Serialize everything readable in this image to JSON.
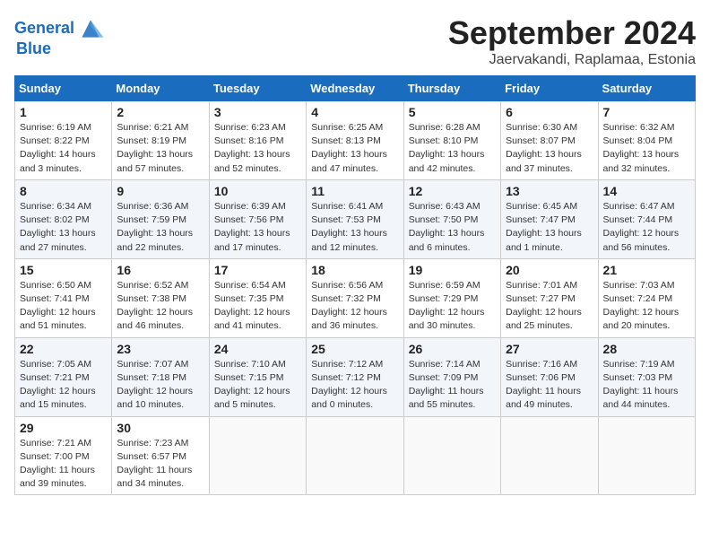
{
  "header": {
    "logo_line1": "General",
    "logo_line2": "Blue",
    "title": "September 2024",
    "subtitle": "Jaervakandi, Raplamaa, Estonia"
  },
  "calendar": {
    "weekdays": [
      "Sunday",
      "Monday",
      "Tuesday",
      "Wednesday",
      "Thursday",
      "Friday",
      "Saturday"
    ],
    "weeks": [
      [
        {
          "day": "",
          "detail": ""
        },
        {
          "day": "2",
          "detail": "Sunrise: 6:21 AM\nSunset: 8:19 PM\nDaylight: 13 hours\nand 57 minutes."
        },
        {
          "day": "3",
          "detail": "Sunrise: 6:23 AM\nSunset: 8:16 PM\nDaylight: 13 hours\nand 52 minutes."
        },
        {
          "day": "4",
          "detail": "Sunrise: 6:25 AM\nSunset: 8:13 PM\nDaylight: 13 hours\nand 47 minutes."
        },
        {
          "day": "5",
          "detail": "Sunrise: 6:28 AM\nSunset: 8:10 PM\nDaylight: 13 hours\nand 42 minutes."
        },
        {
          "day": "6",
          "detail": "Sunrise: 6:30 AM\nSunset: 8:07 PM\nDaylight: 13 hours\nand 37 minutes."
        },
        {
          "day": "7",
          "detail": "Sunrise: 6:32 AM\nSunset: 8:04 PM\nDaylight: 13 hours\nand 32 minutes."
        }
      ],
      [
        {
          "day": "1",
          "detail": "Sunrise: 6:19 AM\nSunset: 8:22 PM\nDaylight: 14 hours\nand 3 minutes."
        },
        {
          "day": "8",
          "detail": "Sunrise: 6:34 AM\nSunset: 8:02 PM\nDaylight: 13 hours\nand 27 minutes."
        },
        {
          "day": "9",
          "detail": "Sunrise: 6:36 AM\nSunset: 7:59 PM\nDaylight: 13 hours\nand 22 minutes."
        },
        {
          "day": "10",
          "detail": "Sunrise: 6:39 AM\nSunset: 7:56 PM\nDaylight: 13 hours\nand 17 minutes."
        },
        {
          "day": "11",
          "detail": "Sunrise: 6:41 AM\nSunset: 7:53 PM\nDaylight: 13 hours\nand 12 minutes."
        },
        {
          "day": "12",
          "detail": "Sunrise: 6:43 AM\nSunset: 7:50 PM\nDaylight: 13 hours\nand 6 minutes."
        },
        {
          "day": "13",
          "detail": "Sunrise: 6:45 AM\nSunset: 7:47 PM\nDaylight: 13 hours\nand 1 minute."
        },
        {
          "day": "14",
          "detail": "Sunrise: 6:47 AM\nSunset: 7:44 PM\nDaylight: 12 hours\nand 56 minutes."
        }
      ],
      [
        {
          "day": "15",
          "detail": "Sunrise: 6:50 AM\nSunset: 7:41 PM\nDaylight: 12 hours\nand 51 minutes."
        },
        {
          "day": "16",
          "detail": "Sunrise: 6:52 AM\nSunset: 7:38 PM\nDaylight: 12 hours\nand 46 minutes."
        },
        {
          "day": "17",
          "detail": "Sunrise: 6:54 AM\nSunset: 7:35 PM\nDaylight: 12 hours\nand 41 minutes."
        },
        {
          "day": "18",
          "detail": "Sunrise: 6:56 AM\nSunset: 7:32 PM\nDaylight: 12 hours\nand 36 minutes."
        },
        {
          "day": "19",
          "detail": "Sunrise: 6:59 AM\nSunset: 7:29 PM\nDaylight: 12 hours\nand 30 minutes."
        },
        {
          "day": "20",
          "detail": "Sunrise: 7:01 AM\nSunset: 7:27 PM\nDaylight: 12 hours\nand 25 minutes."
        },
        {
          "day": "21",
          "detail": "Sunrise: 7:03 AM\nSunset: 7:24 PM\nDaylight: 12 hours\nand 20 minutes."
        }
      ],
      [
        {
          "day": "22",
          "detail": "Sunrise: 7:05 AM\nSunset: 7:21 PM\nDaylight: 12 hours\nand 15 minutes."
        },
        {
          "day": "23",
          "detail": "Sunrise: 7:07 AM\nSunset: 7:18 PM\nDaylight: 12 hours\nand 10 minutes."
        },
        {
          "day": "24",
          "detail": "Sunrise: 7:10 AM\nSunset: 7:15 PM\nDaylight: 12 hours\nand 5 minutes."
        },
        {
          "day": "25",
          "detail": "Sunrise: 7:12 AM\nSunset: 7:12 PM\nDaylight: 12 hours\nand 0 minutes."
        },
        {
          "day": "26",
          "detail": "Sunrise: 7:14 AM\nSunset: 7:09 PM\nDaylight: 11 hours\nand 55 minutes."
        },
        {
          "day": "27",
          "detail": "Sunrise: 7:16 AM\nSunset: 7:06 PM\nDaylight: 11 hours\nand 49 minutes."
        },
        {
          "day": "28",
          "detail": "Sunrise: 7:19 AM\nSunset: 7:03 PM\nDaylight: 11 hours\nand 44 minutes."
        }
      ],
      [
        {
          "day": "29",
          "detail": "Sunrise: 7:21 AM\nSunset: 7:00 PM\nDaylight: 11 hours\nand 39 minutes."
        },
        {
          "day": "30",
          "detail": "Sunrise: 7:23 AM\nSunset: 6:57 PM\nDaylight: 11 hours\nand 34 minutes."
        },
        {
          "day": "",
          "detail": ""
        },
        {
          "day": "",
          "detail": ""
        },
        {
          "day": "",
          "detail": ""
        },
        {
          "day": "",
          "detail": ""
        },
        {
          "day": "",
          "detail": ""
        }
      ]
    ]
  }
}
